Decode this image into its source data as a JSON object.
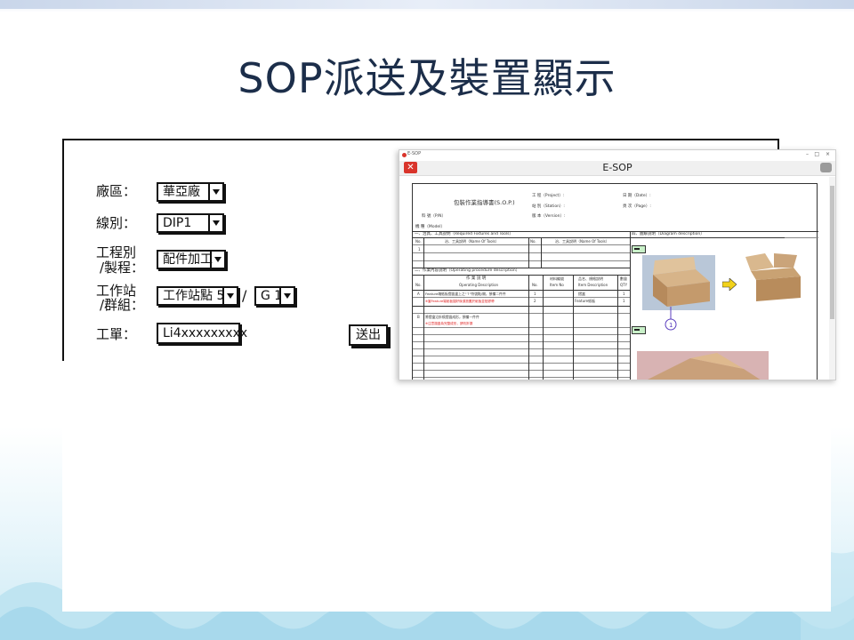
{
  "page": {
    "title": "SOP派送及裝置顯示"
  },
  "form": {
    "factory_label": "廠區：",
    "factory_value": "華亞廠",
    "line_label": "線別：",
    "line_value": "DIP1",
    "process_label_1": "工程別",
    "process_label_2": "/製程：",
    "process_value": "配件加工",
    "station_label_1": "工作站",
    "station_label_2": "/群組：",
    "station_value": "工作站點 5",
    "slash": "/",
    "group_value": "G 1",
    "order_label": "工單：",
    "order_value": "Li4xxxxxxxxx",
    "send_button": "送出"
  },
  "esop": {
    "window_title": "E-SOP",
    "app_title": "E-SOP",
    "close_glyph": "✕",
    "doc": {
      "title": "包裝作業指導書(S.O.P.)",
      "project_label": "工  程（Project）:",
      "station_label": "站  別（Station）:",
      "version_label": "版  本（Version）:",
      "date_label": "日  期（Date）:",
      "page_label": "頁  次（Page）:",
      "pn_label": "料  號（P/N）",
      "model_label": "機  種（Model）",
      "section1": "一、治具、工具說明（Required Fixtures and Tools）",
      "section4": "四、圖解說明（Diagram description）",
      "col_no": "No.",
      "col_tool_name": "治、工具說明（Name Of Tools）",
      "row1_no": "1",
      "section2": "二、作業內容說明（Operating procedure description）",
      "col_op_desc": "作  業  說  明",
      "col_op_desc_en": "Operating Description",
      "col_item_no": "材料編號",
      "col_item_no_en": "Item No",
      "col_item_desc": "品名、規格說明",
      "col_item_desc_en": "Item Description",
      "col_qty": "數量",
      "col_qty_en": "QTY",
      "rowA_id": "A",
      "rowA_text": "Feature端紙板摺疊盒上之\"↑\"符號點/開，預備二件件",
      "rowA_note": "※當Feature端紙板摺好後須放置於紙板並貼膠帶",
      "rowA_no": "1",
      "rowA_item": "摺盒",
      "rowA_qty": "1",
      "rowA2_no": "2",
      "rowA2_item": "Feature紙板",
      "rowA2_qty": "1",
      "rowB_id": "B",
      "rowB_text": "將摺盒沿折痕摺疊成形，預備一件件",
      "rowB_note": "※注意摺盒為完整成形，請勿折損",
      "step_marker": "1"
    }
  },
  "colors": {
    "title": "#1c2e4a",
    "close_red": "#d9342b",
    "arrow_yellow": "#f2d21b",
    "green_icon": "#c8f0c8"
  },
  "icons": [
    "dropdown-arrow-icon",
    "close-icon",
    "esop-settings-icon",
    "yellow-arrow-icon"
  ]
}
